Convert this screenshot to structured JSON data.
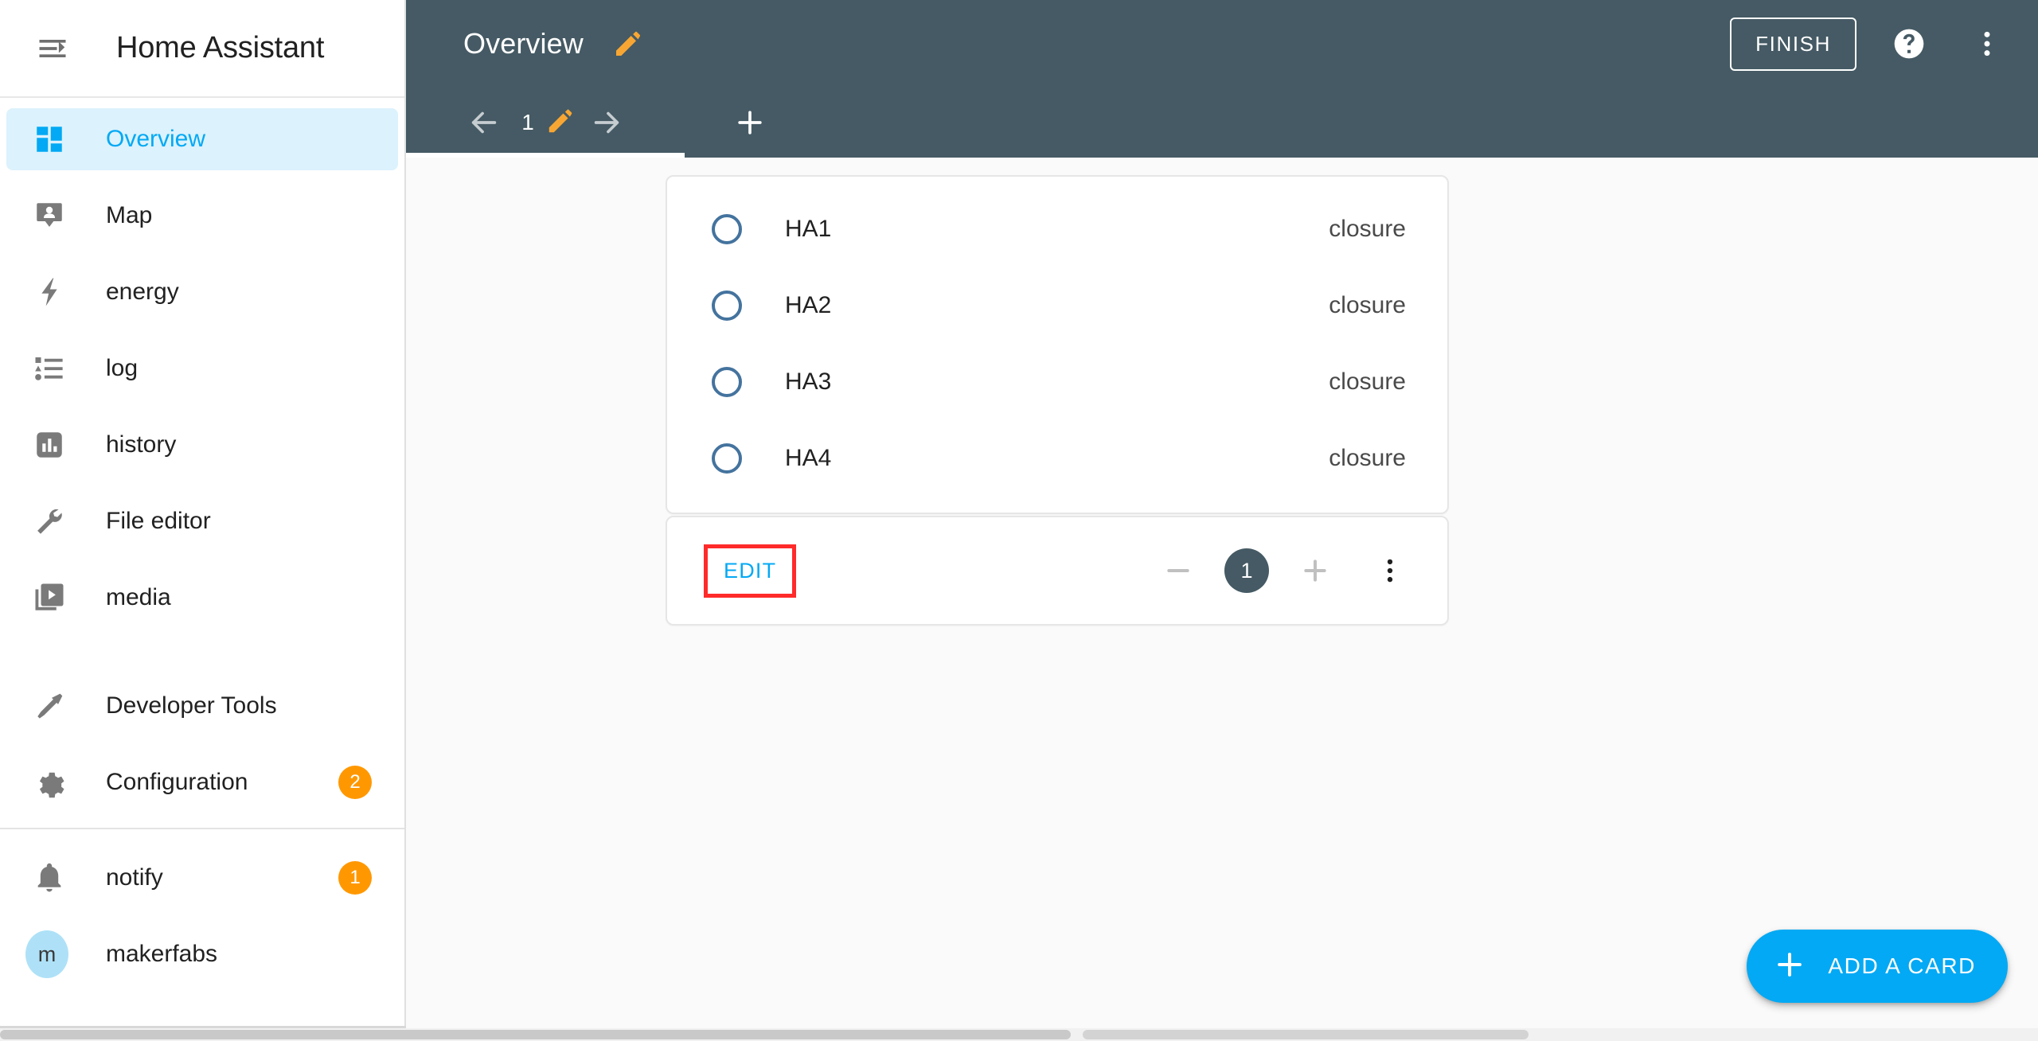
{
  "app": {
    "title": "Home Assistant",
    "menu_icon": "menu-collapse-icon"
  },
  "sidebar": {
    "items": [
      {
        "label": "Overview",
        "icon": "view-dashboard-icon",
        "active": true,
        "badge": null
      },
      {
        "label": "Map",
        "icon": "map-marker-account-icon",
        "active": false,
        "badge": null
      },
      {
        "label": "energy",
        "icon": "lightning-bolt-icon",
        "active": false,
        "badge": null
      },
      {
        "label": "log",
        "icon": "format-list-bulleted-type-icon",
        "active": false,
        "badge": null
      },
      {
        "label": "history",
        "icon": "chart-box-icon",
        "active": false,
        "badge": null
      },
      {
        "label": "File editor",
        "icon": "wrench-icon",
        "active": false,
        "badge": null
      },
      {
        "label": "media",
        "icon": "play-box-multiple-icon",
        "active": false,
        "badge": null
      }
    ],
    "items_group2": [
      {
        "label": "Developer Tools",
        "icon": "hammer-icon",
        "active": false,
        "badge": null
      },
      {
        "label": "Configuration",
        "icon": "cog-icon",
        "active": false,
        "badge": "2"
      }
    ],
    "items_group3": [
      {
        "label": "notify",
        "icon": "bell-icon",
        "active": false,
        "badge": "1"
      },
      {
        "label": "makerfabs",
        "icon": "avatar",
        "avatar_initial": "m",
        "active": false,
        "badge": null
      }
    ]
  },
  "toolbar": {
    "view_title": "Overview",
    "edit_title_icon": "pencil-icon",
    "finish_label": "FINISH",
    "help_icon": "help-circle-icon",
    "overflow_icon": "dots-vertical-icon"
  },
  "tabbar": {
    "prev_icon": "arrow-left-icon",
    "next_icon": "arrow-right-icon",
    "tab_number": "1",
    "tab_edit_icon": "pencil-icon",
    "add_view_icon": "plus-icon"
  },
  "card": {
    "rows": [
      {
        "name": "HA1",
        "state": "closure",
        "icon": "circle-outline-icon"
      },
      {
        "name": "HA2",
        "state": "closure",
        "icon": "circle-outline-icon"
      },
      {
        "name": "HA3",
        "state": "closure",
        "icon": "circle-outline-icon"
      },
      {
        "name": "HA4",
        "state": "closure",
        "icon": "circle-outline-icon"
      }
    ],
    "footer": {
      "edit_label": "EDIT",
      "decrement_icon": "minus-icon",
      "position": "1",
      "increment_icon": "plus-icon",
      "more_icon": "dots-vertical-icon"
    }
  },
  "fab": {
    "icon": "plus-icon",
    "label": "ADD A CARD"
  },
  "colors": {
    "accent": "#03a9f4",
    "toolbar_bg": "#455a64",
    "badge_orange": "#ff9800",
    "pencil_orange": "#f8a633",
    "entity_ring": "#44739e",
    "highlight_red": "#ff2a2a",
    "active_nav_bg": "#dcf2fd"
  }
}
